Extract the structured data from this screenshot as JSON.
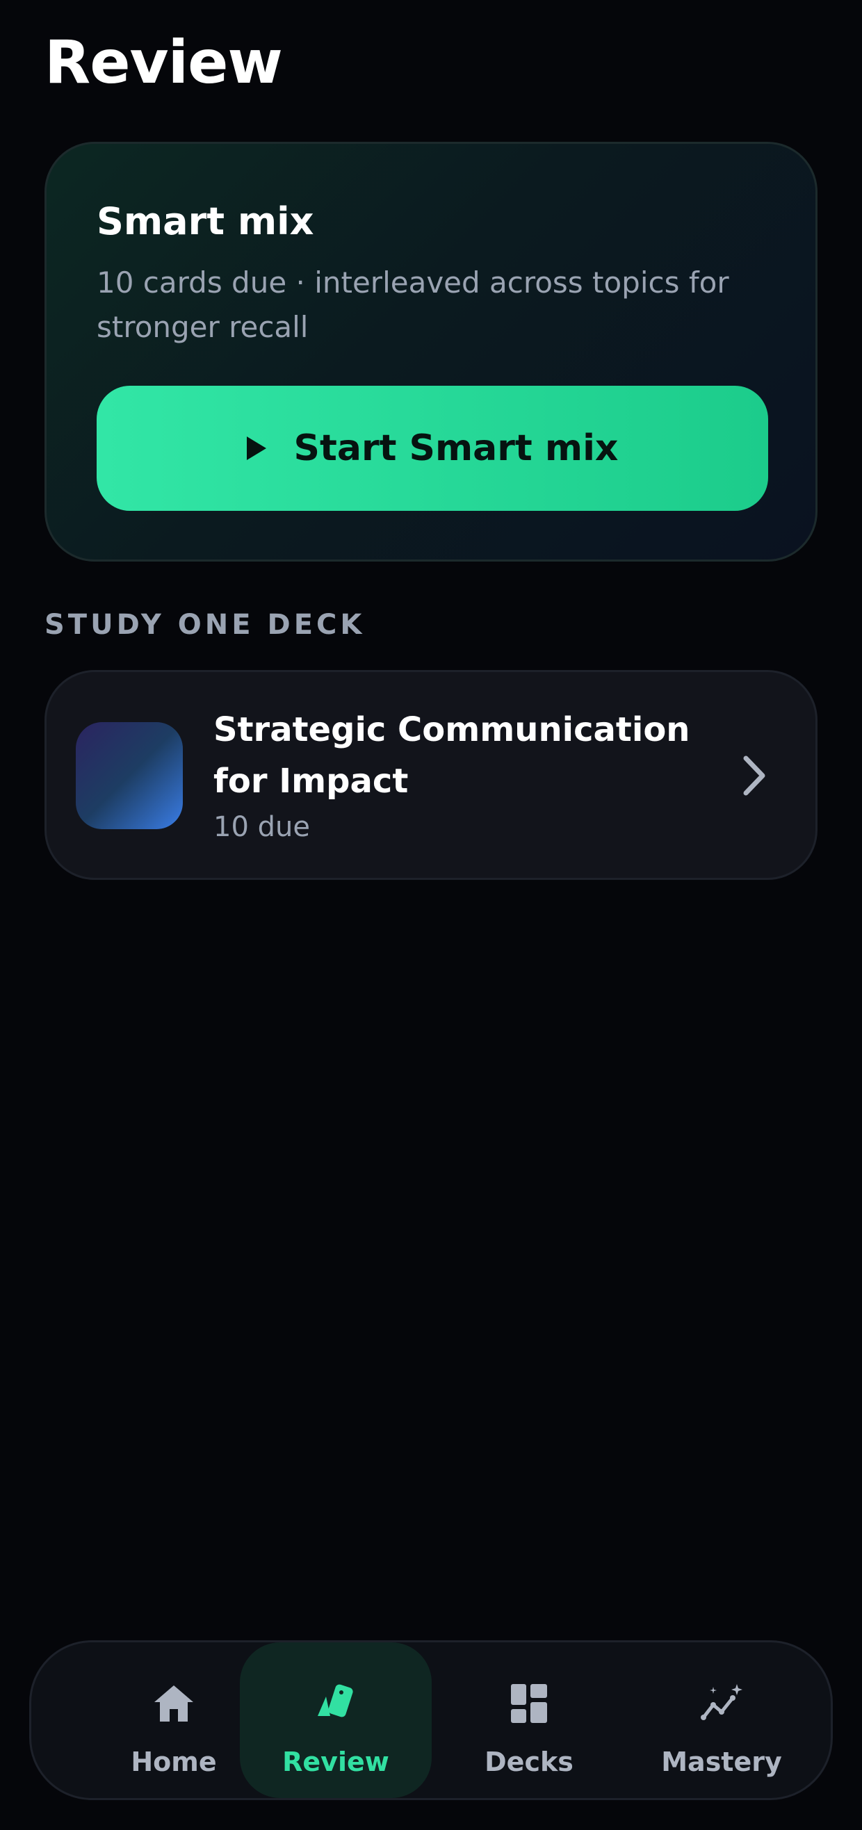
{
  "page": {
    "title": "Review"
  },
  "smart_mix": {
    "title": "Smart mix",
    "subtitle": "10 cards due · interleaved across topics for stronger recall",
    "button_label": "Start Smart mix",
    "button_icon": "play-icon"
  },
  "section": {
    "label": "STUDY ONE DECK"
  },
  "deck": {
    "title": "Strategic Communication for Impact",
    "due": "10 due",
    "chevron_icon": "chevron-right-icon"
  },
  "bottom_nav": {
    "items": [
      {
        "label": "Home",
        "icon": "home-icon",
        "active": false
      },
      {
        "label": "Review",
        "icon": "cards-icon",
        "active": true
      },
      {
        "label": "Decks",
        "icon": "grid-icon",
        "active": false
      },
      {
        "label": "Mastery",
        "icon": "sparkle-chart-icon",
        "active": false
      }
    ]
  },
  "colors": {
    "accent": "#32e6a6",
    "background": "#05060a",
    "card": "#12141b",
    "muted_text": "#9aa3b2"
  }
}
